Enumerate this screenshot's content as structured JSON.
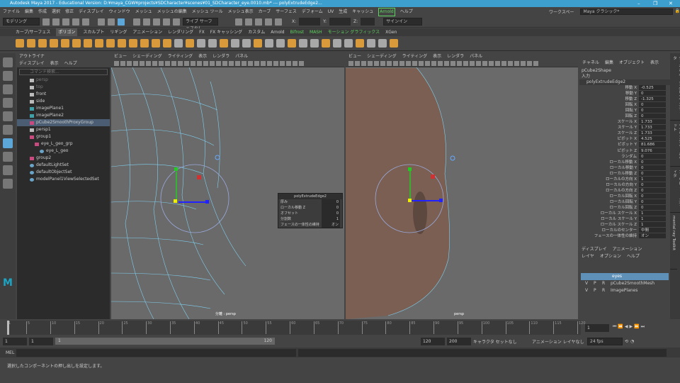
{
  "title": "Autodesk Maya 2017 - Educational Version: D:¥maya_CGW¥projects¥SDCharacter¥scenes¥01_SDCharacter_eye.0010.mb*  ---  polyExtrudeEdge2...",
  "menu": [
    "ファイル",
    "編集",
    "作成",
    "選択",
    "修正",
    "ディスプレイ",
    "ウィンドウ",
    "メッシュ",
    "メッシュの編集",
    "メッシュ ツール",
    "メッシュ表示",
    "カーブ",
    "サーフェス",
    "デフォーム",
    "UV",
    "生成",
    "キャッシュ",
    "Arnold",
    "ヘルプ"
  ],
  "workspace": {
    "label": "ワークスペース:",
    "value": "Maya クラシック*"
  },
  "toolbar": {
    "mode": "モデリング",
    "symmetry": "シンメトリ: オフ",
    "xyz": [
      "X:",
      "Y:",
      "Z:"
    ],
    "sign_in": "サインイン",
    "soft": "ライブ サーフェスなし"
  },
  "shelf_tabs": [
    "カーブ/サーフェス",
    "ポリゴン",
    "スカルプト",
    "リギング",
    "アニメーション",
    "レンダリング",
    "FX",
    "FX キャッシング",
    "カスタム",
    "Arnold",
    "Bifrost",
    "MASH",
    "モーション グラフィックス",
    "XGen"
  ],
  "outliner": {
    "title": "アウトライナ",
    "menu": [
      "ディスプレイ",
      "表示",
      "ヘルプ"
    ],
    "search_placeholder": "コマンド検索...",
    "items": [
      {
        "label": "persp",
        "type": "camera",
        "depth": 0,
        "dim": true
      },
      {
        "label": "top",
        "type": "camera",
        "depth": 0,
        "dim": true
      },
      {
        "label": "front",
        "type": "camera",
        "depth": 0
      },
      {
        "label": "side",
        "type": "camera",
        "depth": 0
      },
      {
        "label": "imagePlane1",
        "type": "plane",
        "depth": 0
      },
      {
        "label": "imagePlane2",
        "type": "plane",
        "depth": 0
      },
      {
        "label": "pCube2SmoothProxyGroup",
        "type": "group",
        "depth": 0,
        "selected": true
      },
      {
        "label": "persp1",
        "type": "camera",
        "depth": 0
      },
      {
        "label": "group1",
        "type": "group",
        "depth": 0
      },
      {
        "label": "eye_L_geo_grp",
        "type": "group",
        "depth": 1
      },
      {
        "label": "eye_L_geo",
        "type": "mesh",
        "depth": 2
      },
      {
        "label": "group2",
        "type": "group",
        "depth": 0
      },
      {
        "label": "defaultLightSet",
        "type": "set",
        "depth": 0
      },
      {
        "label": "defaultObjectSet",
        "type": "set",
        "depth": 0
      },
      {
        "label": "modelPanel1ViewSelectedSet",
        "type": "set",
        "depth": 0
      }
    ]
  },
  "viewport_menu": [
    "ビュー",
    "シェーディング",
    "ライティング",
    "表示",
    "レンダラ",
    "パネル"
  ],
  "viewports": {
    "left_label": "分離 : persp",
    "right_label": "persp"
  },
  "popup": {
    "title": "polyExtrudeEdge2",
    "rows": [
      {
        "label": "厚み",
        "value": "0"
      },
      {
        "label": "ローカル移動 Z",
        "value": "0"
      },
      {
        "label": "オフセット",
        "value": "0"
      },
      {
        "label": "分割数",
        "value": "1"
      },
      {
        "label": "フェースの一体性の維持",
        "value": "オン"
      }
    ]
  },
  "channel_box": {
    "menu": [
      "チャネル",
      "編集",
      "オブジェクト",
      "表示"
    ],
    "shape": "pCube2Shape",
    "inputs": "入力",
    "node": "polyExtrudeEdge2",
    "rows": [
      [
        "移動 X",
        "-0.525"
      ],
      [
        "移動 Y",
        "0"
      ],
      [
        "移動 Z",
        "-1.325"
      ],
      [
        "回転 X",
        "0"
      ],
      [
        "回転 Y",
        "0"
      ],
      [
        "回転 Z",
        "0"
      ],
      [
        "スケール X",
        "1.733"
      ],
      [
        "スケール Y",
        "1.733"
      ],
      [
        "スケール Z",
        "1.733"
      ],
      [
        "ピボット X",
        "4.525"
      ],
      [
        "ピボット Y",
        "81.686"
      ],
      [
        "ピボット Z",
        "9.076"
      ],
      [
        "ランダム",
        "0"
      ],
      [
        "ローカル移動 X",
        "0"
      ],
      [
        "ローカル移動 Y",
        "0"
      ],
      [
        "ローカル移動 Z",
        "0"
      ],
      [
        "ローカルの方向 X",
        "1"
      ],
      [
        "ローカルの方向 Y",
        "0"
      ],
      [
        "ローカルの方向 Z",
        "0"
      ],
      [
        "ローカル回転 X",
        "0"
      ],
      [
        "ローカル回転 Y",
        "0"
      ],
      [
        "ローカル回転 Z",
        "0"
      ],
      [
        "ローカル スケール X",
        "1"
      ],
      [
        "ローカル スケール Y",
        "1"
      ],
      [
        "ローカル スケール Z",
        "1"
      ],
      [
        "ローカルのセンター",
        "中間"
      ],
      [
        "フェースの一体性の維持",
        "オン"
      ]
    ]
  },
  "side_tabs": [
    "チャネル ボックス/レイヤ エディタ",
    "モデリング ツールキット",
    "アトリビュート エディタ",
    "mental ray Toolkit"
  ],
  "layers": {
    "tabs": [
      "ディスプレイ",
      "アニメーション"
    ],
    "menu": [
      "レイヤ",
      "オプション",
      "ヘルプ"
    ],
    "rows": [
      {
        "v": "",
        "p": "",
        "r": "",
        "name": "eyes",
        "selected": true
      },
      {
        "v": "V",
        "p": "P",
        "r": "R",
        "name": "pCube2SmoothMesh"
      },
      {
        "v": "V",
        "p": "P",
        "r": "R",
        "name": "ImagePlanes"
      }
    ]
  },
  "timeline": {
    "ticks": [
      "1",
      "5",
      "10",
      "15",
      "20",
      "25",
      "30",
      "35",
      "40",
      "45",
      "50",
      "55",
      "60",
      "65",
      "70",
      "75",
      "80",
      "85",
      "90",
      "95",
      "100",
      "105",
      "110",
      "115",
      "120"
    ],
    "current_frame": "1"
  },
  "range": {
    "start": "1",
    "anim_start": "1",
    "range_start": "1",
    "range_end": "120",
    "anim_end": "120",
    "end": "200",
    "character_set": "キャラクタ セットなし",
    "anim_layer": "アニメーション レイヤなし",
    "fps": "24 fps"
  },
  "mel": {
    "label": "MEL"
  },
  "help_line": "選択したコンポーネントの押し出しを設定します。",
  "colors": {
    "title": "#3d9fce",
    "selection": "#5e90b8",
    "wire": "#7fd0f0",
    "skin": "#7a5f52"
  }
}
